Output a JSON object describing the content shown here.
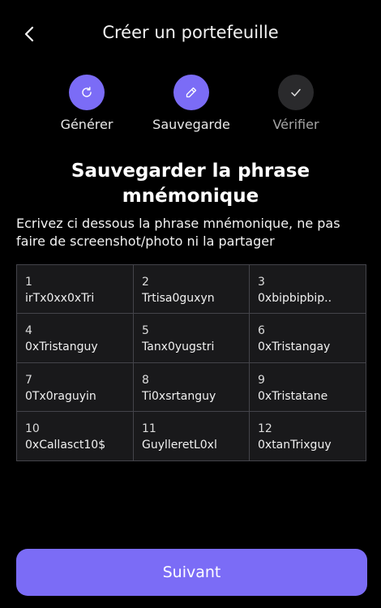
{
  "header": {
    "title": "Créer un portefeuille",
    "back_icon": "chevron-left"
  },
  "steps": [
    {
      "label": "Générer",
      "icon": "refresh-icon",
      "state": "active"
    },
    {
      "label": "Sauvegarde",
      "icon": "pencil-icon",
      "state": "active"
    },
    {
      "label": "Vérifier",
      "icon": "check-icon",
      "state": "inactive"
    }
  ],
  "section": {
    "title": "Sauvegarder la phrase mnémonique",
    "description": "Ecrivez ci dessous la phrase mnémonique, ne pas faire de screenshot/photo ni la partager"
  },
  "mnemonic": [
    {
      "num": "1",
      "word": "irTx0xx0xTri"
    },
    {
      "num": "2",
      "word": "Trtisa0guxyn"
    },
    {
      "num": "3",
      "word": "0xbipbipbip.."
    },
    {
      "num": "4",
      "word": "0xTristanguy"
    },
    {
      "num": "5",
      "word": "Tanx0yugstri"
    },
    {
      "num": "6",
      "word": "0xTristangay"
    },
    {
      "num": "7",
      "word": "0Tx0raguyin"
    },
    {
      "num": "8",
      "word": "Ti0xsrtanguy"
    },
    {
      "num": "9",
      "word": "0xTristatane"
    },
    {
      "num": "10",
      "word": "0xCallasct10$"
    },
    {
      "num": "11",
      "word": "GuylleretL0xl"
    },
    {
      "num": "12",
      "word": "0xtanTrixguy"
    }
  ],
  "footer": {
    "next_label": "Suivant"
  },
  "colors": {
    "accent": "#7b6cf6",
    "background": "#000000",
    "grid_bg": "#19191b",
    "grid_border": "#44444a"
  }
}
